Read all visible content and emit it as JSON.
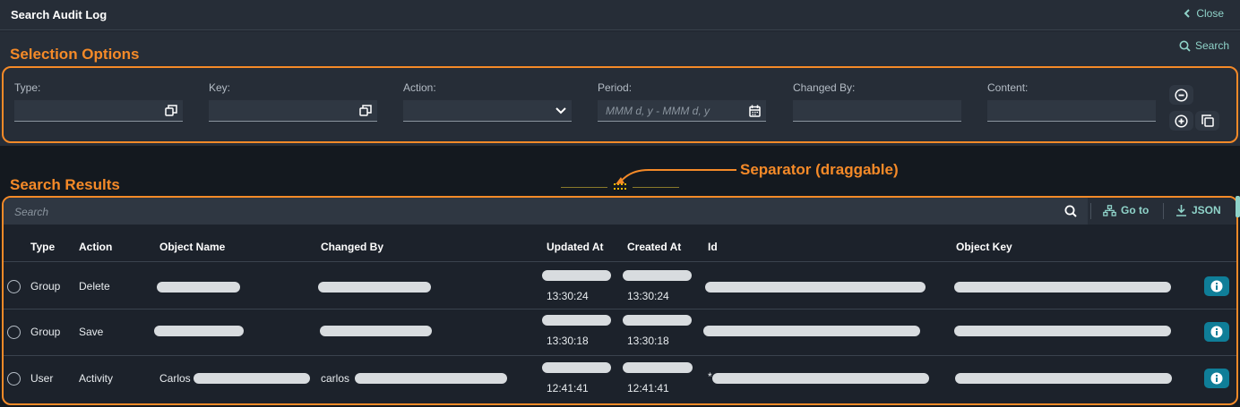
{
  "window": {
    "title": "Search Audit Log",
    "close_label": "Close"
  },
  "annotations": {
    "selection_options": "Selection Options",
    "search_results": "Search Results",
    "separator": "Separator (draggable)"
  },
  "filter_bar": {
    "search_label": "Search",
    "fields": [
      {
        "label": "Type:",
        "value": "",
        "icon": "value-help-icon"
      },
      {
        "label": "Key:",
        "value": "",
        "icon": "value-help-icon"
      },
      {
        "label": "Action:",
        "value": "",
        "icon": "chevron-down-icon"
      },
      {
        "label": "Period:",
        "placeholder": "MMM d, y - MMM d, y",
        "icon": "calendar-icon"
      },
      {
        "label": "Changed By:",
        "value": ""
      },
      {
        "label": "Content:",
        "value": ""
      }
    ]
  },
  "results": {
    "search_placeholder": "Search",
    "goto_label": "Go to",
    "json_label": "JSON",
    "columns": [
      "Type",
      "Action",
      "Object Name",
      "Changed By",
      "Updated At",
      "Created At",
      "Id",
      "Object Key"
    ],
    "rows": [
      {
        "type": "Group",
        "action": "Delete",
        "object_name": "",
        "changed_by": "",
        "updated_time": "13:30:24",
        "created_time": "13:30:24",
        "id": "",
        "object_key": ""
      },
      {
        "type": "Group",
        "action": "Save",
        "object_name": "",
        "changed_by": "",
        "updated_time": "13:30:18",
        "created_time": "13:30:18",
        "id": "",
        "object_key": ""
      },
      {
        "type": "User",
        "action": "Activity",
        "object_name": "Carlos",
        "changed_by": "carlos",
        "updated_time": "12:41:41",
        "created_time": "12:41:41",
        "id": "*",
        "object_key": ""
      }
    ]
  },
  "colors": {
    "annotation": "#f58a28",
    "accent": "#8fd3c9",
    "info_button": "#0f7e98"
  }
}
